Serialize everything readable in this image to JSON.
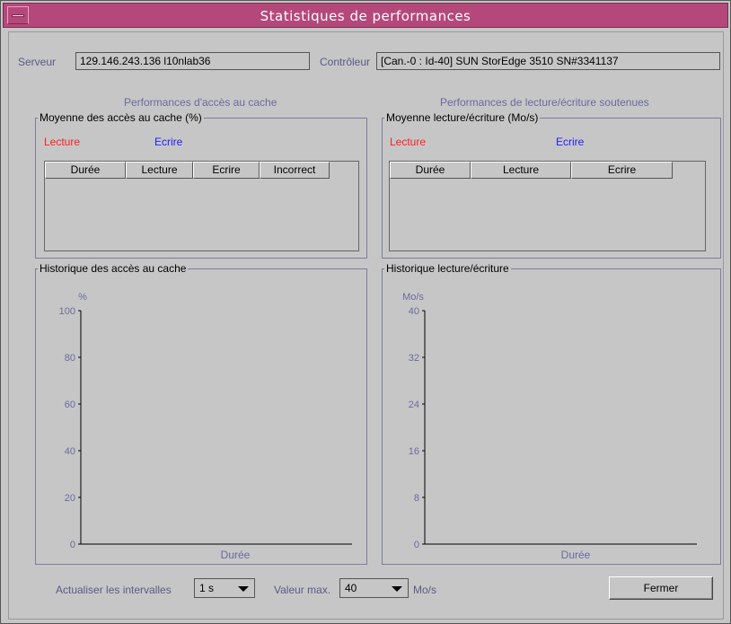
{
  "window": {
    "title": "Statistiques de performances"
  },
  "server": {
    "label": "Serveur",
    "value": "129.146.243.136 l10nlab36"
  },
  "controller": {
    "label": "Contrôleur",
    "value": "[Can.-0 : Id-40] SUN StorEdge 3510 SN#3341137"
  },
  "cache_section": {
    "caption": "Performances d'accès au cache",
    "average_title": "Moyenne des accès au cache (%)",
    "legend_read": "Lecture",
    "legend_write": "Ecrire",
    "columns": [
      "Durée",
      "Lecture",
      "Ecrire",
      "Incorrect"
    ],
    "history_title": "Historique des accès au cache"
  },
  "rw_section": {
    "caption": "Performances de lecture/écriture soutenues",
    "average_title": "Moyenne lecture/écriture (Mo/s)",
    "legend_read": "Lecture",
    "legend_write": "Ecrire",
    "columns": [
      "Durée",
      "Lecture",
      "Ecrire"
    ],
    "history_title": "Historique lecture/écriture"
  },
  "chart_data": [
    {
      "type": "line",
      "title": "Historique des accès au cache",
      "ylabel": "%",
      "xlabel": "Durée",
      "yticks": [
        0,
        20,
        40,
        60,
        80,
        100
      ],
      "ylim": [
        0,
        100
      ],
      "series": []
    },
    {
      "type": "line",
      "title": "Historique lecture/écriture",
      "ylabel": "Mo/s",
      "xlabel": "Durée",
      "yticks": [
        0,
        8,
        16,
        24,
        32,
        40
      ],
      "ylim": [
        0,
        40
      ],
      "series": []
    }
  ],
  "footer": {
    "interval_label": "Actualiser les intervalles",
    "interval_value": "1 s",
    "max_label": "Valeur max.",
    "max_value": "40",
    "max_unit": "Mo/s",
    "close_button": "Fermer"
  },
  "colors": {
    "titlebar": "#b5487a",
    "read": "#ff2020",
    "write": "#2020ff",
    "label": "#6a6aa0"
  }
}
